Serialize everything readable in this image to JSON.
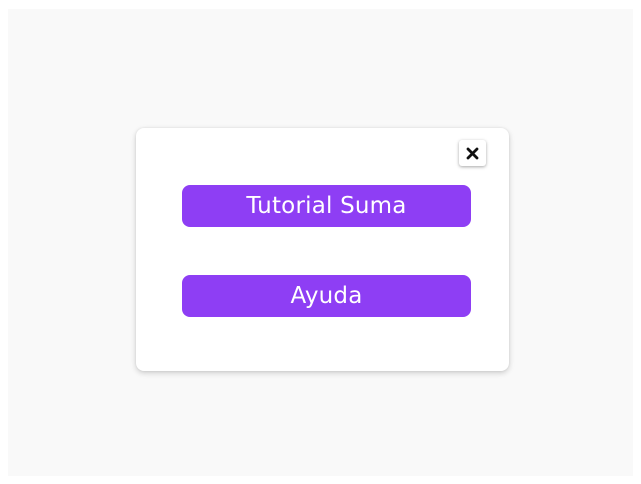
{
  "dialog": {
    "close_icon": "close-icon",
    "buttons": {
      "tutorial_label": "Tutorial Suma",
      "help_label": "Ayuda"
    }
  },
  "colors": {
    "backdrop": "#f9f9f9",
    "dialog_background": "#ffffff",
    "button_background": "#8e3ef4",
    "button_text": "#ffffff"
  }
}
